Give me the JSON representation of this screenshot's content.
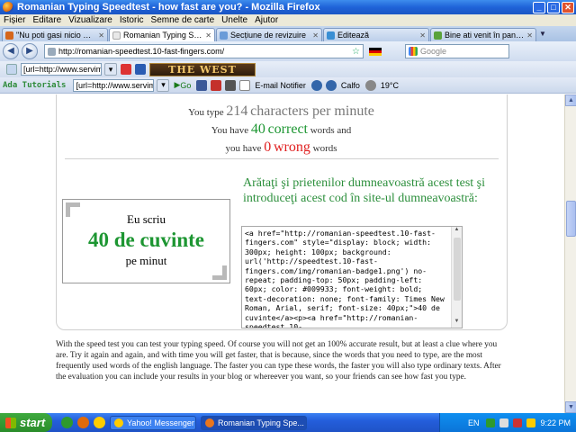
{
  "window": {
    "title": "Romanian Typing Speedtest - how fast are you? - Mozilla Firefox"
  },
  "menu": [
    "Fișier",
    "Editare",
    "Vizualizare",
    "Istoric",
    "Semne de carte",
    "Unelte",
    "Ajutor"
  ],
  "tabs": [
    {
      "label": "\"Nu poti gasi nicio munca aici\" ...",
      "icon_color": "#d5661c",
      "active": false
    },
    {
      "label": "Romanian Typing Speedtest - ...",
      "icon_color": "#e8e8e8",
      "active": true
    },
    {
      "label": "Secțiune de revizuire",
      "icon_color": "#6a9bd8",
      "active": false
    },
    {
      "label": "Editează",
      "icon_color": "#3a8fd4",
      "active": false
    },
    {
      "label": "Bine ati venit în panoul dvs...",
      "icon_color": "#5aa23a",
      "active": false
    }
  ],
  "nav": {
    "url": "http://romanian-speedtest.10-fast-fingers.com/",
    "search_placeholder": "Google"
  },
  "toolbar2": {
    "input_value": "[url=http://www.servimg.",
    "logo_text": "THE WEST"
  },
  "toolbar3": {
    "label": "Ada Tutorials",
    "input_value": "[url=http://www.servimg.",
    "go_label": "Go",
    "notifier_label": "E-mail Notifier",
    "status_label": "Calfo",
    "weather_label": "19°C"
  },
  "results": {
    "line1_prefix": "You type",
    "cpm": "214",
    "line1_suffix": "characters per minute",
    "line2_prefix": "You have",
    "correct_count": "40",
    "correct_word": "correct",
    "line2_suffix": "words and",
    "line3_prefix": "you have",
    "wrong_count": "0",
    "wrong_word": "wrong",
    "line3_suffix": "words"
  },
  "badge": {
    "line1": "Eu scriu",
    "line2": "40 de cuvinte",
    "line3": "pe minut"
  },
  "share": {
    "title": "Arătaţi şi prietenilor dumneavoastră acest test şi introduceţi acest cod în site-ul dumneavoastră:",
    "code": "<a href=\"http://romanian-speedtest.10-fast-fingers.com\" style=\"display: block; width: 300px; height: 100px; background: url('http://speedtest.10-fast-fingers.com/img/romanian-badge1.png') no-repeat; padding-top: 50px; padding-left: 60px; color: #009933; font-weight: bold; text-decoration: none; font-family: Times New Roman, Arial, serif; font-size: 40px;\">40 de cuvinte</a><p><a href=\"http://romanian-speedtest.10-"
  },
  "description": "With the speed test you can test your typing speed. Of course you will not get an 100% accurate result, but at least a clue where you are. Try it again and again, and with time you will get faster, that is because, since the words that you need to type, are the most frequently used words of the english language. The faster you can type these words, the faster you will also type ordinary texts. After the evaluation you can include your results in your blog or whereever you want, so your friends can see how fast you type.",
  "taskbar": {
    "start_label": "start",
    "buttons": [
      {
        "label": "Yahoo! Messenger",
        "icon_color": "#ffcc00",
        "active": false
      },
      {
        "label": "Romanian Typing Spe...",
        "icon_color": "#e8761d",
        "active": true
      }
    ],
    "tray": {
      "lang": "EN",
      "time": "9:22 PM"
    }
  }
}
